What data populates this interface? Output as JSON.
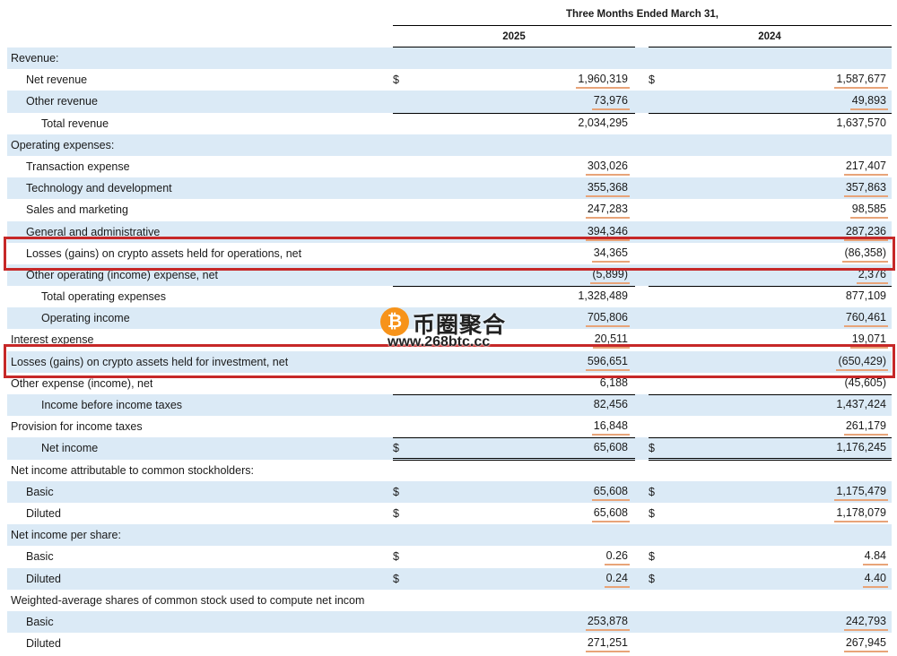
{
  "header": {
    "period": "Three Months Ended March 31,",
    "year_1": "2025",
    "year_2": "2024"
  },
  "rows": [
    {
      "label": "Revenue:",
      "indent": 0
    },
    {
      "label": "Net revenue",
      "indent": 1,
      "cur1": "$",
      "v1": "1,960,319",
      "cur2": "$",
      "v2": "1,587,677",
      "mark": "u"
    },
    {
      "label": "Other revenue",
      "indent": 1,
      "v1": "73,976",
      "v2": "49,893",
      "mark": "u"
    },
    {
      "label": "Total revenue",
      "indent": 2,
      "v1": "2,034,295",
      "v2": "1,637,570",
      "total": true
    },
    {
      "label": "Operating expenses:",
      "indent": 0
    },
    {
      "label": "Transaction expense",
      "indent": 1,
      "v1": "303,026",
      "v2": "217,407",
      "mark": "u"
    },
    {
      "label": "Technology and development",
      "indent": 1,
      "v1": "355,368",
      "v2": "357,863",
      "mark": "u"
    },
    {
      "label": "Sales and marketing",
      "indent": 1,
      "v1": "247,283",
      "v2": "98,585",
      "mark": "u"
    },
    {
      "label": "General and administrative",
      "indent": 1,
      "v1": "394,346",
      "v2": "287,236",
      "mark": "u"
    },
    {
      "label": "Losses (gains) on crypto assets held for operations, net",
      "indent": 1,
      "v1": "34,365",
      "v2": "(86,358)",
      "mark": "u",
      "highlight": true
    },
    {
      "label": "Other operating (income) expense, net",
      "indent": 1,
      "v1": "(5,899)",
      "v2": "2,376",
      "mark": "u"
    },
    {
      "label": "Total operating expenses",
      "indent": 2,
      "v1": "1,328,489",
      "v2": "877,109",
      "total": true
    },
    {
      "label": "Operating income",
      "indent": 2,
      "v1": "705,806",
      "v2": "760,461",
      "mark": "u"
    },
    {
      "label": "Interest expense",
      "indent": 0,
      "v1": "20,511",
      "v2": "19,071",
      "mark": "u"
    },
    {
      "label": "Losses (gains) on crypto assets held for investment, net",
      "indent": 0,
      "v1": "596,651",
      "v2": "(650,429)",
      "mark": "u",
      "highlight": true
    },
    {
      "label": "Other expense (income), net",
      "indent": 0,
      "v1": "6,188",
      "v2": "(45,605)"
    },
    {
      "label": "Income before income taxes",
      "indent": 2,
      "v1": "82,456",
      "v2": "1,437,424",
      "total": true
    },
    {
      "label": "Provision for income taxes",
      "indent": 0,
      "v1": "16,848",
      "v2": "261,179",
      "mark": "u"
    },
    {
      "label": "Net income",
      "indent": 2,
      "cur1": "$",
      "v1": "65,608",
      "cur2": "$",
      "v2": "1,176,245",
      "total": true,
      "double": true
    },
    {
      "label": "Net income attributable to common stockholders:",
      "indent": 0
    },
    {
      "label": "Basic",
      "indent": 1,
      "cur1": "$",
      "v1": "65,608",
      "cur2": "$",
      "v2": "1,175,479",
      "mark": "u"
    },
    {
      "label": "Diluted",
      "indent": 1,
      "cur1": "$",
      "v1": "65,608",
      "cur2": "$",
      "v2": "1,178,079",
      "mark": "u"
    },
    {
      "label": "Net income per share:",
      "indent": 0
    },
    {
      "label": "Basic",
      "indent": 1,
      "cur1": "$",
      "v1": "0.26",
      "cur2": "$",
      "v2": "4.84",
      "mark": "u"
    },
    {
      "label": "Diluted",
      "indent": 1,
      "cur1": "$",
      "v1": "0.24",
      "cur2": "$",
      "v2": "4.40",
      "mark": "u"
    },
    {
      "label": "Weighted-average shares of common stock used to compute net income per share:",
      "indent": 0
    },
    {
      "label": "Basic",
      "indent": 1,
      "v1": "253,878",
      "v2": "242,793",
      "mark": "u"
    },
    {
      "label": "Diluted",
      "indent": 1,
      "v1": "271,251",
      "v2": "267,945",
      "mark": "u"
    }
  ],
  "watermark": {
    "coin_symbol": "₿",
    "name": "币圈聚合",
    "url": "www.268btc.cc"
  },
  "colors": {
    "row_shade": "#dbeaf6",
    "highlight_box": "#c62828",
    "underline_mark": "#e8a479",
    "coin": "#f7931a"
  }
}
